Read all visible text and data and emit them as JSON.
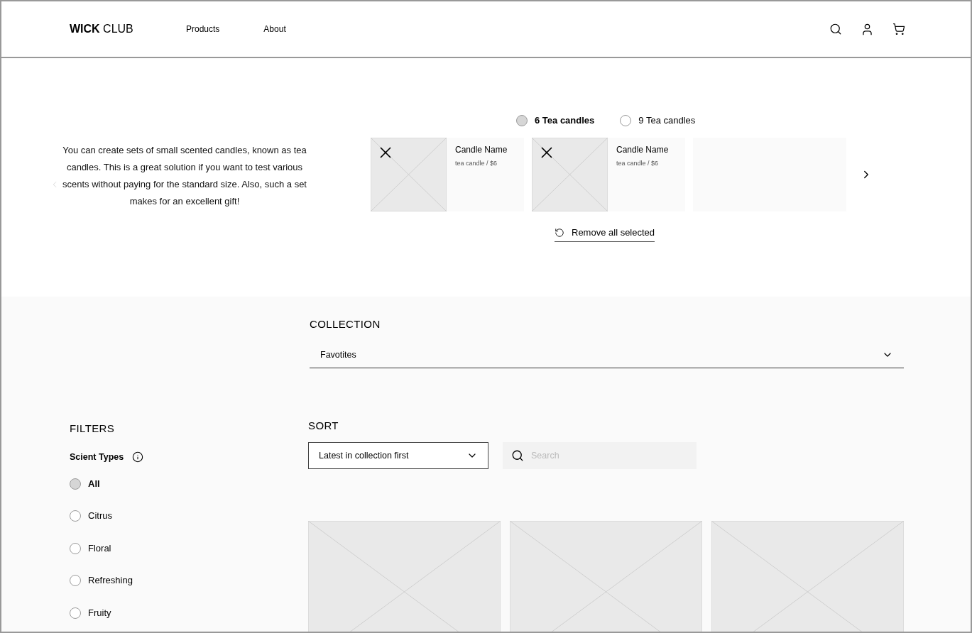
{
  "header": {
    "logo_bold": "WICK",
    "logo_rest": "CLUB",
    "nav": [
      "Products",
      "About"
    ]
  },
  "builder": {
    "description": "You can create sets of small scented candles, known as tea candles. This is a great solution if you want to test various scents without paying for the standard size. Also, such a set makes for an excellent gift!",
    "set_sizes": [
      {
        "label": "6 Tea candles",
        "selected": true
      },
      {
        "label": "9 Tea candles",
        "selected": false
      }
    ],
    "slots": [
      {
        "kind": "filled",
        "name": "Candle Name",
        "detail": "tea candle / $6"
      },
      {
        "kind": "filled",
        "name": "Candle Name",
        "detail": "tea candle / $6"
      },
      {
        "kind": "empty"
      }
    ],
    "remove_all": "Remove all selected"
  },
  "collection": {
    "heading": "COLLECTION",
    "value": "Favotites"
  },
  "filters": {
    "heading": "FILTERS",
    "group": "Scient Types",
    "options": [
      {
        "label": "All",
        "selected": true
      },
      {
        "label": "Citrus",
        "selected": false
      },
      {
        "label": "Floral",
        "selected": false
      },
      {
        "label": "Refreshing",
        "selected": false
      },
      {
        "label": "Fruity",
        "selected": false
      }
    ]
  },
  "sort": {
    "heading": "SORT",
    "value": "Latest in collection first"
  },
  "search": {
    "placeholder": "Search"
  }
}
